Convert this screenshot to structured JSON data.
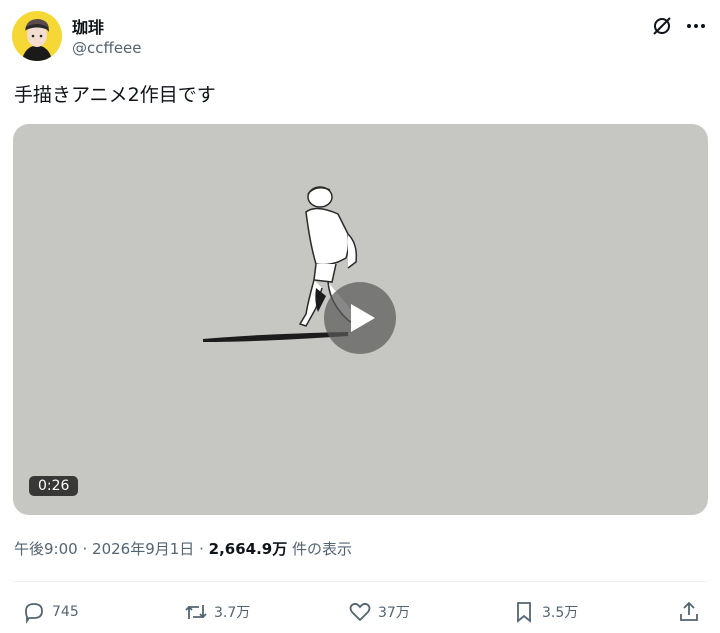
{
  "author": {
    "name": "珈琲",
    "handle": "@ccffeee"
  },
  "tweet": {
    "text": "手描きアニメ2作目です"
  },
  "video": {
    "duration": "0:26"
  },
  "meta": {
    "time": "午後9:00",
    "separator1": "·",
    "date": "2026年9月1日",
    "separator2": "·",
    "views_count": "2,664.9万",
    "views_label": "件の表示"
  },
  "actions": {
    "replies": "745",
    "retweets": "3.7万",
    "likes": "37万",
    "bookmarks": "3.5万"
  },
  "colors": {
    "accent_gray": "#536471",
    "video_bg": "#c6c6c3",
    "avatar_bg": "#f5d836"
  },
  "icons": [
    "grok-icon",
    "more-icon",
    "reply-icon",
    "retweet-icon",
    "like-icon",
    "bookmark-icon",
    "share-icon",
    "play-icon"
  ]
}
